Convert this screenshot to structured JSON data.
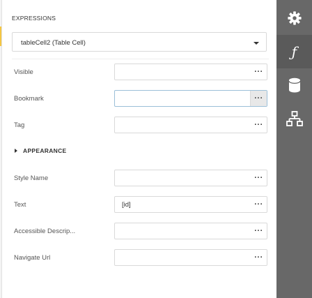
{
  "section": {
    "title": "EXPRESSIONS"
  },
  "selector": {
    "value": "tableCell2 (Table Cell)"
  },
  "properties": [
    {
      "label": "Visible",
      "value": ""
    },
    {
      "label": "Bookmark",
      "value": ""
    },
    {
      "label": "Tag",
      "value": ""
    }
  ],
  "appearance": {
    "title": "APPEARANCE",
    "properties": [
      {
        "label": "Style Name",
        "value": ""
      },
      {
        "label": "Text",
        "value": "[id]"
      },
      {
        "label": "Accessible Descrip...",
        "value": ""
      },
      {
        "label": "Navigate Url",
        "value": ""
      }
    ]
  },
  "ellipsis": "···",
  "sidebar": {
    "items": [
      {
        "icon": "gear-icon",
        "active": false
      },
      {
        "icon": "function-icon",
        "symbol": "ƒ",
        "active": true
      },
      {
        "icon": "database-icon",
        "active": false
      },
      {
        "icon": "hierarchy-icon",
        "active": false
      }
    ]
  },
  "colors": {
    "sidebar": "#686868",
    "sidebar_active": "#5a5a5a",
    "focus_border": "#9bbfd8"
  }
}
